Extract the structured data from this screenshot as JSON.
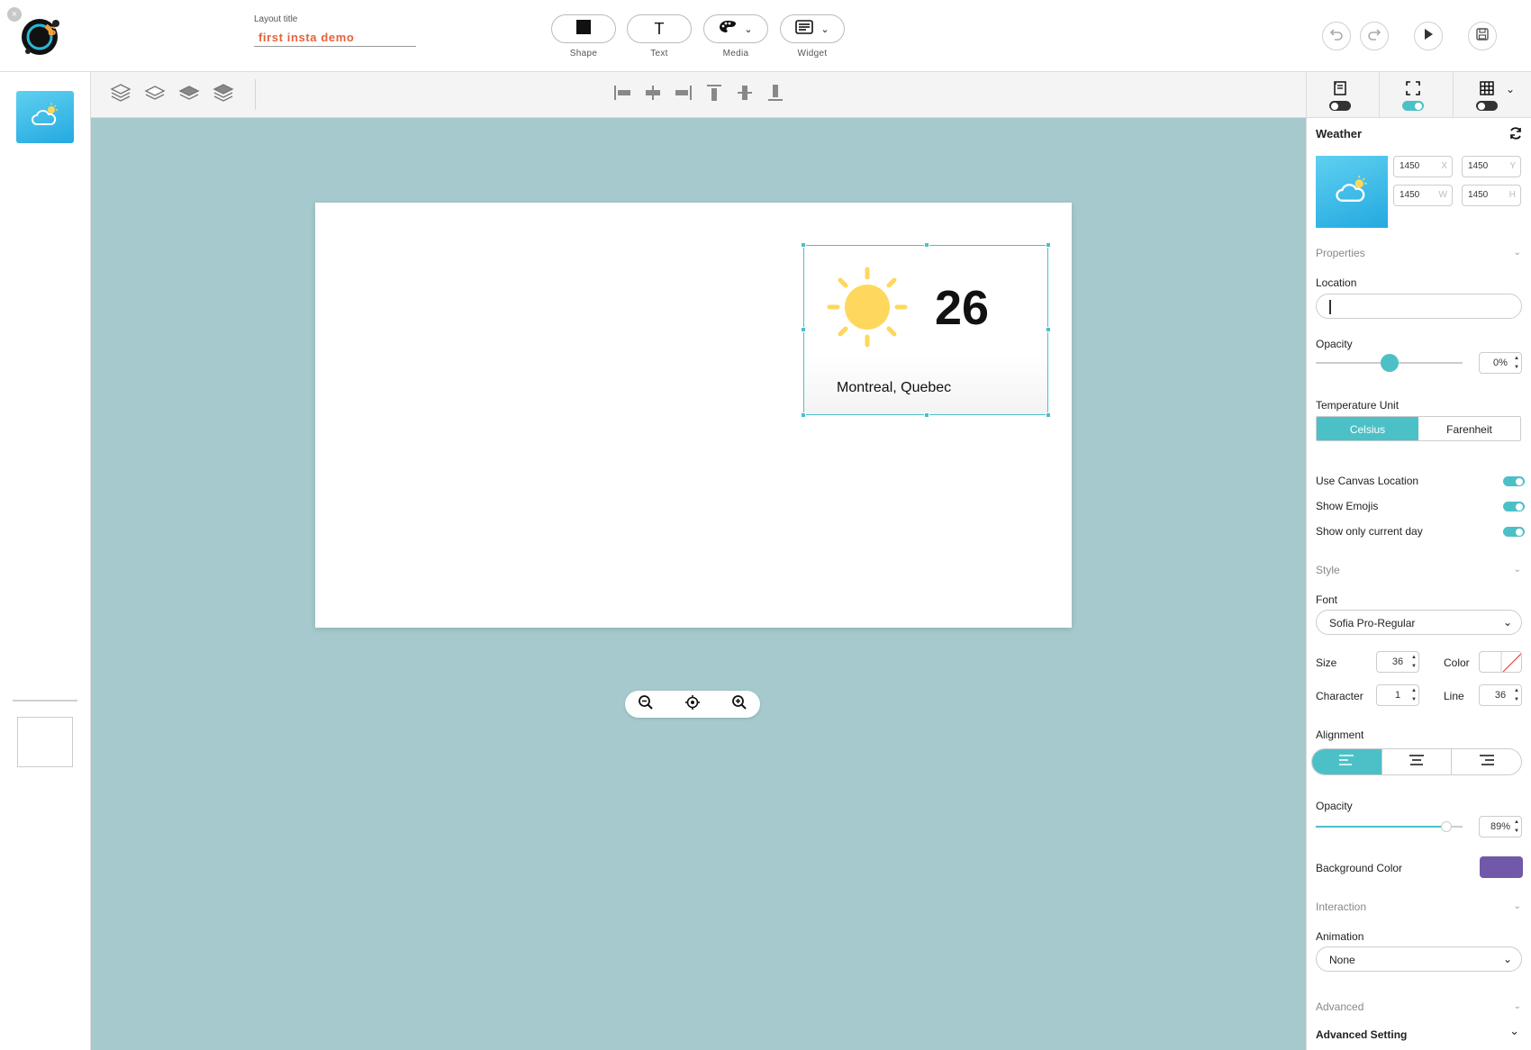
{
  "app": {
    "close_label": "×",
    "title_label": "Layout title",
    "title_value": "first insta demo"
  },
  "tools": [
    {
      "label": "Shape",
      "icon": "square-icon"
    },
    {
      "label": "Text",
      "icon": "text-icon",
      "glyph": "T"
    },
    {
      "label": "Media",
      "icon": "palette-icon"
    },
    {
      "label": "Widget",
      "icon": "widget-icon"
    }
  ],
  "top_actions": [
    "undo-icon",
    "redo-icon",
    "play-icon",
    "save-icon"
  ],
  "canvas": {
    "background": "#a5c9cc",
    "widget": {
      "temperature": "26",
      "location": "Montreal, Quebec",
      "icon": "sun-icon"
    }
  },
  "panel": {
    "widget_title": "Weather",
    "coords": [
      {
        "value": "1450",
        "axis": "X"
      },
      {
        "value": "1450",
        "axis": "Y"
      },
      {
        "value": "1450",
        "axis": "W"
      },
      {
        "value": "1450",
        "axis": "H"
      }
    ],
    "properties_label": "Properties",
    "location_label": "Location",
    "location_value": "",
    "opacity_label": "Opacity",
    "opacity_value": "0%",
    "opacity_fraction": 0.5,
    "temp_unit_label": "Temperature Unit",
    "temp_units": [
      "Celsius",
      "Farenheit"
    ],
    "temp_unit_selected": "Celsius",
    "toggles": [
      {
        "label": "Use Canvas Location",
        "on": true
      },
      {
        "label": "Show Emojis",
        "on": true
      },
      {
        "label": "Show only current day",
        "on": true
      }
    ],
    "style_label": "Style",
    "font_label": "Font",
    "font_value": "Sofia Pro-Regular",
    "size_label": "Size",
    "size_value": "36",
    "color_label": "Color",
    "character_label": "Character",
    "character_value": "1",
    "line_label": "Line",
    "line_value": "36",
    "alignment_label": "Alignment",
    "alignment_selected": "left",
    "opacity2_label": "Opacity",
    "opacity2_value": "89%",
    "opacity2_fraction": 0.89,
    "bg_color_label": "Background Color",
    "bg_color": "#7258a8",
    "interaction_label": "Interaction",
    "animation_label": "Animation",
    "animation_value": "None",
    "advanced_label": "Advanced",
    "advanced_setting_label": "Advanced Setting"
  },
  "colors": {
    "accent": "#4cc0c7",
    "title": "#e8623a",
    "sun": "#fdd85d"
  }
}
